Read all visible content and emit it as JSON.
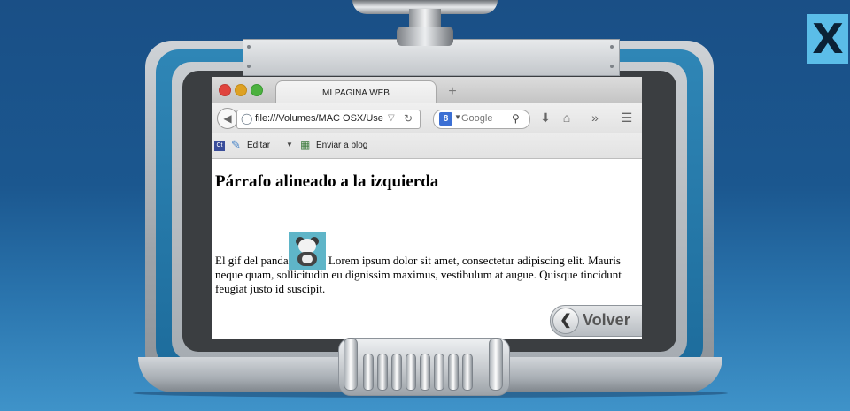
{
  "close_button": {
    "label": "X"
  },
  "browser": {
    "tab_title": "MI PAGINA WEB",
    "new_tab_symbol": "+",
    "url": "file:///Volumes/MAC OSX/Use",
    "search_engine_icon": "8",
    "search_placeholder": "Google",
    "bookmarks": [
      {
        "label": "Editar"
      },
      {
        "label": "Enviar a blog"
      }
    ],
    "bookmark_badge": "Ct"
  },
  "page": {
    "heading": "Párrafo alineado a la izquierda",
    "paragraph_before_image": "El gif del panda",
    "paragraph_after_image": " Lorem ipsum dolor sit amet, consectetur adipiscing elit. Mauris neque quam, sollicitudin eu dignissim maximus, vestibulum at augue. Quisque tincidunt feugiat justo id suscipit."
  },
  "back_button": {
    "label": "Volver"
  },
  "icons": [
    "close-icon",
    "back-arrow-icon",
    "globe-icon",
    "reload-icon",
    "search-icon",
    "download-icon",
    "home-icon",
    "overflow-icon",
    "menu-icon",
    "edit-icon",
    "blog-icon",
    "panda-image",
    "chevron-left-icon"
  ],
  "colors": {
    "background": "#1b578f",
    "frame_blue": "#2f86b6",
    "close_button": "#5bbde8",
    "panda_bg": "#5fb5c8"
  }
}
